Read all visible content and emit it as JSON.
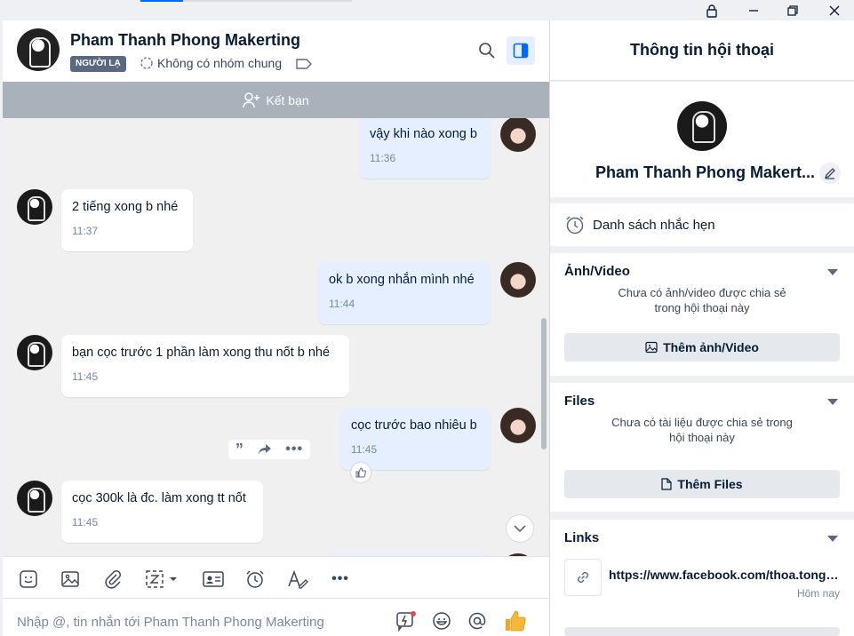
{
  "header": {
    "name": "Pham Thanh Phong Makerting",
    "badge": "NGƯỜI LẠ",
    "group_text": "Không có nhóm chung"
  },
  "friend_bar": {
    "label": "Kết bạn"
  },
  "messages": [
    {
      "sender": "me",
      "text": "vậy khi nào xong b",
      "time": "11:36"
    },
    {
      "sender": "other",
      "text": "2 tiếng xong b nhé",
      "time": "11:37"
    },
    {
      "sender": "me",
      "text": "ok b xong nhắn mình nhé",
      "time": "11:44"
    },
    {
      "sender": "other",
      "text": "bạn cọc trước 1 phần làm xong thu nốt b nhé",
      "time": "11:45"
    },
    {
      "sender": "me",
      "text": "cọc trước bao nhiêu b",
      "time": "11:45"
    },
    {
      "sender": "other",
      "text": "cọc 300k là đc. làm xong tt nốt",
      "time": "11:45"
    }
  ],
  "composer": {
    "placeholder": "Nhập @, tin nhắn tới Pham Thanh Phong Makerting"
  },
  "info": {
    "title": "Thông tin hội thoại",
    "profile_name": "Pham Thanh Phong Makert...",
    "reminders_label": "Danh sách nhắc hẹn",
    "media": {
      "title": "Ảnh/Video",
      "empty_line1": "Chưa có ảnh/video được chia sẻ",
      "empty_line2": "trong hội thoại này",
      "button": "Thêm ảnh/Video"
    },
    "files": {
      "title": "Files",
      "empty_line1": "Chưa có tài liệu được chia sẻ trong",
      "empty_line2": "hội thoại này",
      "button": "Thêm Files"
    },
    "links": {
      "title": "Links",
      "url": "https://www.facebook.com/thoa.tongc...",
      "time": "Hôm nay"
    }
  },
  "colors": {
    "accent": "#0068ff",
    "bubble_me": "#e5efff",
    "bubble_other": "#ffffff",
    "friend_bar": "#a9b1bb"
  }
}
